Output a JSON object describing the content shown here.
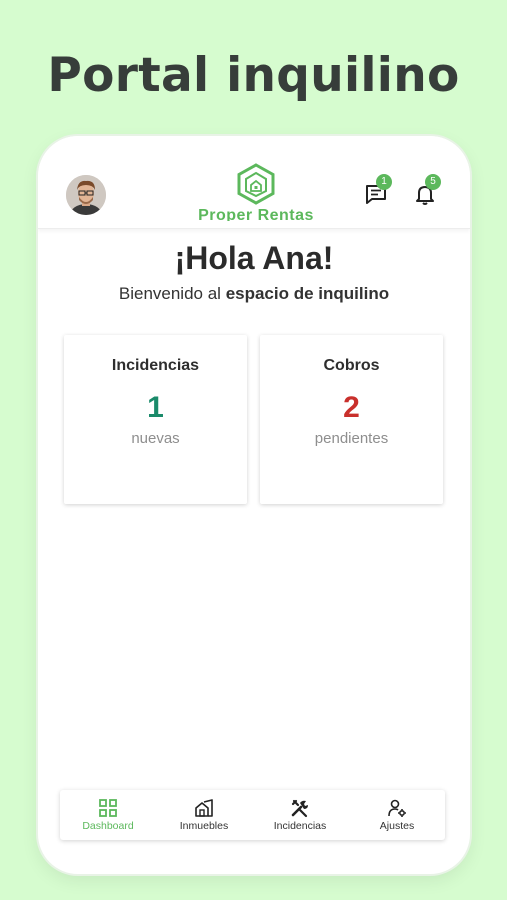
{
  "screen_title": "Portal inquilino",
  "header": {
    "logo_text": "Proper Rentas",
    "messages_badge": "1",
    "notifications_badge": "5"
  },
  "greeting": {
    "title": "¡Hola Ana!",
    "welcome_prefix": "Bienvenido al ",
    "welcome_bold": "espacio de inquilino"
  },
  "cards": [
    {
      "title": "Incidencias",
      "value": "1",
      "subtitle": "nuevas",
      "color": "#1a8a6a"
    },
    {
      "title": "Cobros",
      "value": "2",
      "subtitle": "pendientes",
      "color": "#c9302c"
    }
  ],
  "bottom_nav": [
    {
      "label": "Dashboard",
      "icon": "dashboard-icon",
      "active": true
    },
    {
      "label": "Inmuebles",
      "icon": "buildings-icon",
      "active": false
    },
    {
      "label": "Incidencias",
      "icon": "tools-icon",
      "active": false
    },
    {
      "label": "Ajustes",
      "icon": "user-settings-icon",
      "active": false
    }
  ],
  "colors": {
    "background": "#d6fccf",
    "brand": "#5cb85c",
    "incidencias_value": "#1a8a6a",
    "cobros_value": "#c9302c"
  }
}
